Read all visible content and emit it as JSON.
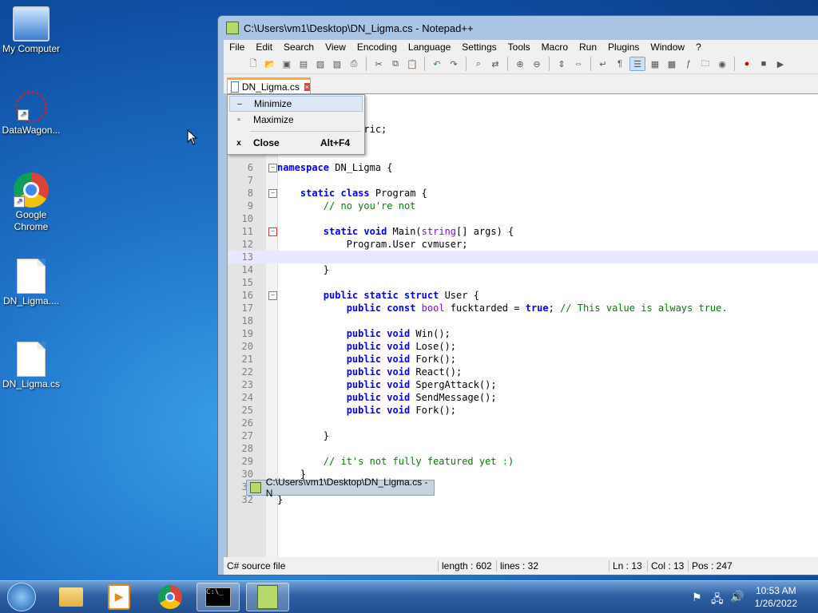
{
  "desktop": {
    "icons": [
      {
        "label": "My Computer"
      },
      {
        "label": "DataWagon..."
      },
      {
        "label": "Google Chrome"
      },
      {
        "label": "DN_Ligma...."
      },
      {
        "label": "DN_Ligma.cs"
      }
    ]
  },
  "window": {
    "title": "C:\\Users\\vm1\\Desktop\\DN_Ligma.cs - Notepad++",
    "menu": [
      "File",
      "Edit",
      "Search",
      "View",
      "Encoding",
      "Language",
      "Settings",
      "Tools",
      "Macro",
      "Run",
      "Plugins",
      "Window",
      "?"
    ],
    "tab": {
      "label": "DN_Ligma.cs"
    },
    "context_menu": {
      "items": [
        {
          "glyph": "–",
          "label": "Minimize",
          "shortcut": ""
        },
        {
          "glyph": "▫",
          "label": "Maximize",
          "shortcut": ""
        },
        {
          "glyph": "x",
          "label": "Close",
          "shortcut": "Alt+F4"
        }
      ]
    },
    "tooltip": "C:\\Users\\vm1\\Desktop\\DN_Ligma.cs - N",
    "status": {
      "type": "C# source file",
      "length": "length : 602",
      "lines": "lines : 32",
      "ln": "Ln : 13",
      "col": "Col : 13",
      "pos": "Pos : 247"
    }
  },
  "code_lines": [
    {
      "n": "",
      "text": "ollections;"
    },
    {
      "n": "",
      "text": "ollections.Generic;"
    },
    {
      "n": "",
      "text": "eployment;"
    },
    {
      "n": "6",
      "text": "namespace DN_Ligma {"
    },
    {
      "n": "7",
      "text": ""
    },
    {
      "n": "8",
      "text": "    static class Program {"
    },
    {
      "n": "9",
      "text": "        // no you're not"
    },
    {
      "n": "10",
      "text": ""
    },
    {
      "n": "11",
      "text": "        static void Main(string[] args) {"
    },
    {
      "n": "12",
      "text": "            Program.User cvmuser;"
    },
    {
      "n": "13",
      "text": ""
    },
    {
      "n": "14",
      "text": "        }"
    },
    {
      "n": "15",
      "text": ""
    },
    {
      "n": "16",
      "text": "        public static struct User {"
    },
    {
      "n": "17",
      "text": "            public const bool fucktarded = true; // This value is always true."
    },
    {
      "n": "18",
      "text": ""
    },
    {
      "n": "19",
      "text": "            public void Win();"
    },
    {
      "n": "20",
      "text": "            public void Lose();"
    },
    {
      "n": "21",
      "text": "            public void Fork();"
    },
    {
      "n": "22",
      "text": "            public void React();"
    },
    {
      "n": "23",
      "text": "            public void SpergAttack();"
    },
    {
      "n": "24",
      "text": "            public void SendMessage();"
    },
    {
      "n": "25",
      "text": "            public void Fork();"
    },
    {
      "n": "26",
      "text": ""
    },
    {
      "n": "27",
      "text": "        }"
    },
    {
      "n": "28",
      "text": ""
    },
    {
      "n": "29",
      "text": "        // it's not fully featured yet :)"
    },
    {
      "n": "30",
      "text": "    }"
    },
    {
      "n": "31",
      "text": ""
    },
    {
      "n": "32",
      "text": "}"
    }
  ],
  "taskbar": {
    "time": "10:53 AM",
    "date": "1/26/2022"
  }
}
